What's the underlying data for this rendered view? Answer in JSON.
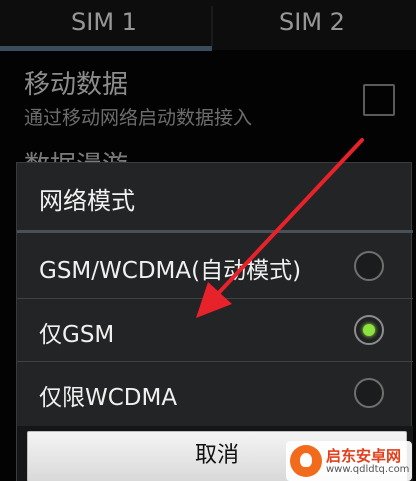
{
  "tabs": [
    {
      "label": "SIM 1",
      "selected": true
    },
    {
      "label": "SIM 2",
      "selected": false
    }
  ],
  "settings": {
    "mobile_data": {
      "title": "移动数据",
      "subtitle": "通过移动网络启动数据接入",
      "checked": false
    },
    "roaming": {
      "title": "数据漫游"
    }
  },
  "dialog": {
    "title": "网络模式",
    "options": [
      {
        "label": "GSM/WCDMA(自动模式)",
        "selected": false
      },
      {
        "label": "仅GSM",
        "selected": true
      },
      {
        "label": "仅限WCDMA",
        "selected": false
      }
    ],
    "cancel_label": "取消"
  },
  "watermark": {
    "name": "启东安卓网",
    "url": "www.qdldtq.com"
  },
  "colors": {
    "accent_tab": "#5a7590",
    "radio_selected": "#8de33d",
    "annotation_arrow": "#e8222a"
  }
}
